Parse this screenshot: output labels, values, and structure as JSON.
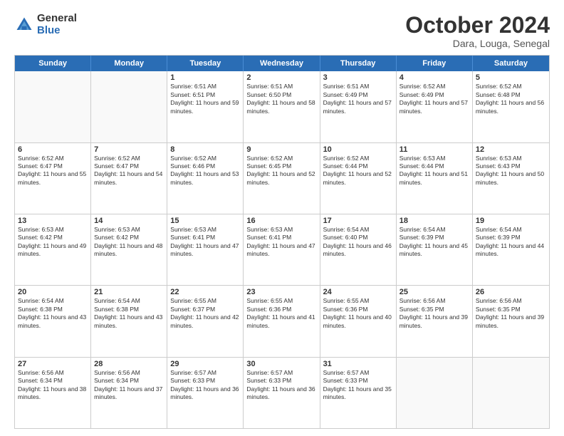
{
  "header": {
    "logo_general": "General",
    "logo_blue": "Blue",
    "month_title": "October 2024",
    "location": "Dara, Louga, Senegal"
  },
  "weekdays": [
    "Sunday",
    "Monday",
    "Tuesday",
    "Wednesday",
    "Thursday",
    "Friday",
    "Saturday"
  ],
  "rows": [
    [
      {
        "day": "",
        "text": ""
      },
      {
        "day": "",
        "text": ""
      },
      {
        "day": "1",
        "text": "Sunrise: 6:51 AM\nSunset: 6:51 PM\nDaylight: 11 hours and 59 minutes."
      },
      {
        "day": "2",
        "text": "Sunrise: 6:51 AM\nSunset: 6:50 PM\nDaylight: 11 hours and 58 minutes."
      },
      {
        "day": "3",
        "text": "Sunrise: 6:51 AM\nSunset: 6:49 PM\nDaylight: 11 hours and 57 minutes."
      },
      {
        "day": "4",
        "text": "Sunrise: 6:52 AM\nSunset: 6:49 PM\nDaylight: 11 hours and 57 minutes."
      },
      {
        "day": "5",
        "text": "Sunrise: 6:52 AM\nSunset: 6:48 PM\nDaylight: 11 hours and 56 minutes."
      }
    ],
    [
      {
        "day": "6",
        "text": "Sunrise: 6:52 AM\nSunset: 6:47 PM\nDaylight: 11 hours and 55 minutes."
      },
      {
        "day": "7",
        "text": "Sunrise: 6:52 AM\nSunset: 6:47 PM\nDaylight: 11 hours and 54 minutes."
      },
      {
        "day": "8",
        "text": "Sunrise: 6:52 AM\nSunset: 6:46 PM\nDaylight: 11 hours and 53 minutes."
      },
      {
        "day": "9",
        "text": "Sunrise: 6:52 AM\nSunset: 6:45 PM\nDaylight: 11 hours and 52 minutes."
      },
      {
        "day": "10",
        "text": "Sunrise: 6:52 AM\nSunset: 6:44 PM\nDaylight: 11 hours and 52 minutes."
      },
      {
        "day": "11",
        "text": "Sunrise: 6:53 AM\nSunset: 6:44 PM\nDaylight: 11 hours and 51 minutes."
      },
      {
        "day": "12",
        "text": "Sunrise: 6:53 AM\nSunset: 6:43 PM\nDaylight: 11 hours and 50 minutes."
      }
    ],
    [
      {
        "day": "13",
        "text": "Sunrise: 6:53 AM\nSunset: 6:42 PM\nDaylight: 11 hours and 49 minutes."
      },
      {
        "day": "14",
        "text": "Sunrise: 6:53 AM\nSunset: 6:42 PM\nDaylight: 11 hours and 48 minutes."
      },
      {
        "day": "15",
        "text": "Sunrise: 6:53 AM\nSunset: 6:41 PM\nDaylight: 11 hours and 47 minutes."
      },
      {
        "day": "16",
        "text": "Sunrise: 6:53 AM\nSunset: 6:41 PM\nDaylight: 11 hours and 47 minutes."
      },
      {
        "day": "17",
        "text": "Sunrise: 6:54 AM\nSunset: 6:40 PM\nDaylight: 11 hours and 46 minutes."
      },
      {
        "day": "18",
        "text": "Sunrise: 6:54 AM\nSunset: 6:39 PM\nDaylight: 11 hours and 45 minutes."
      },
      {
        "day": "19",
        "text": "Sunrise: 6:54 AM\nSunset: 6:39 PM\nDaylight: 11 hours and 44 minutes."
      }
    ],
    [
      {
        "day": "20",
        "text": "Sunrise: 6:54 AM\nSunset: 6:38 PM\nDaylight: 11 hours and 43 minutes."
      },
      {
        "day": "21",
        "text": "Sunrise: 6:54 AM\nSunset: 6:38 PM\nDaylight: 11 hours and 43 minutes."
      },
      {
        "day": "22",
        "text": "Sunrise: 6:55 AM\nSunset: 6:37 PM\nDaylight: 11 hours and 42 minutes."
      },
      {
        "day": "23",
        "text": "Sunrise: 6:55 AM\nSunset: 6:36 PM\nDaylight: 11 hours and 41 minutes."
      },
      {
        "day": "24",
        "text": "Sunrise: 6:55 AM\nSunset: 6:36 PM\nDaylight: 11 hours and 40 minutes."
      },
      {
        "day": "25",
        "text": "Sunrise: 6:56 AM\nSunset: 6:35 PM\nDaylight: 11 hours and 39 minutes."
      },
      {
        "day": "26",
        "text": "Sunrise: 6:56 AM\nSunset: 6:35 PM\nDaylight: 11 hours and 39 minutes."
      }
    ],
    [
      {
        "day": "27",
        "text": "Sunrise: 6:56 AM\nSunset: 6:34 PM\nDaylight: 11 hours and 38 minutes."
      },
      {
        "day": "28",
        "text": "Sunrise: 6:56 AM\nSunset: 6:34 PM\nDaylight: 11 hours and 37 minutes."
      },
      {
        "day": "29",
        "text": "Sunrise: 6:57 AM\nSunset: 6:33 PM\nDaylight: 11 hours and 36 minutes."
      },
      {
        "day": "30",
        "text": "Sunrise: 6:57 AM\nSunset: 6:33 PM\nDaylight: 11 hours and 36 minutes."
      },
      {
        "day": "31",
        "text": "Sunrise: 6:57 AM\nSunset: 6:33 PM\nDaylight: 11 hours and 35 minutes."
      },
      {
        "day": "",
        "text": ""
      },
      {
        "day": "",
        "text": ""
      }
    ]
  ]
}
